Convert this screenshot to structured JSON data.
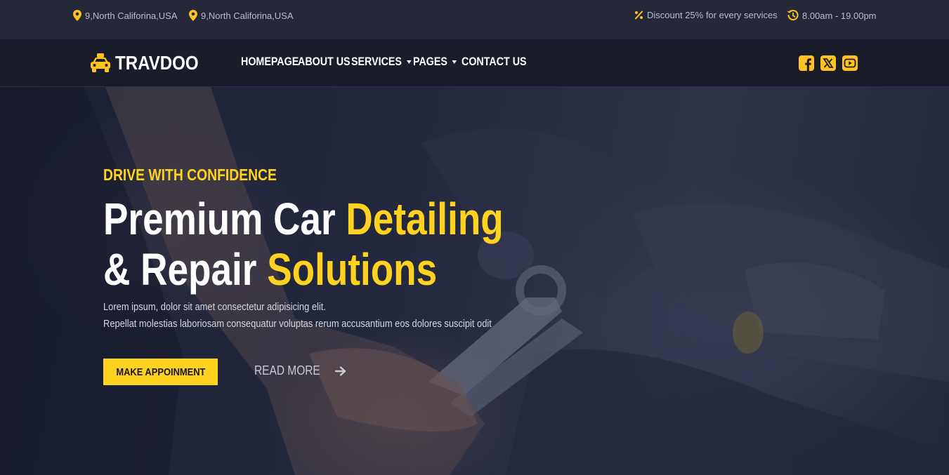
{
  "topbar": {
    "address_1": "9,North Califorina,USA",
    "address_2": "9,North Califorina,USA",
    "discount": "Discount 25% for every services",
    "hours": "8.00am - 19.00pm",
    "icons": [
      "location-pin-icon",
      "percent-icon",
      "clock-icon"
    ]
  },
  "navbar": {
    "brand": "TRAVDOO",
    "brand_icon": "taxi-car-icon",
    "items": [
      {
        "label": "HOMEPAGE",
        "dropdown": false
      },
      {
        "label": "ABOUT US",
        "dropdown": false
      },
      {
        "label": "SERVICES",
        "dropdown": true
      },
      {
        "label": "PAGES",
        "dropdown": true
      },
      {
        "label": "CONTACT US",
        "dropdown": false
      }
    ],
    "socials": [
      "facebook-icon",
      "x-twitter-icon",
      "youtube-icon"
    ]
  },
  "hero": {
    "eyebrow": "DRIVE WITH CONFIDENCE",
    "headline_line1_a": "Premium Car ",
    "headline_line1_b": "Detailing",
    "headline_line2_a": "& Repair ",
    "headline_line2_b": "Solutions",
    "desc_line1": "Lorem ipsum, dolor sit amet consectetur adipisicing elit.",
    "desc_line2": "Repellat molestias laboriosam consequatur voluptas rerum accusantium eos dolores suscipit odit",
    "primary_button": "MAKE APPOINMENT",
    "secondary_button": "READ MORE"
  },
  "colors": {
    "accent": "#ffd21f",
    "topbar_bg": "#242839",
    "navbar_bg": "#1a1d29",
    "text": "#ffffff"
  }
}
